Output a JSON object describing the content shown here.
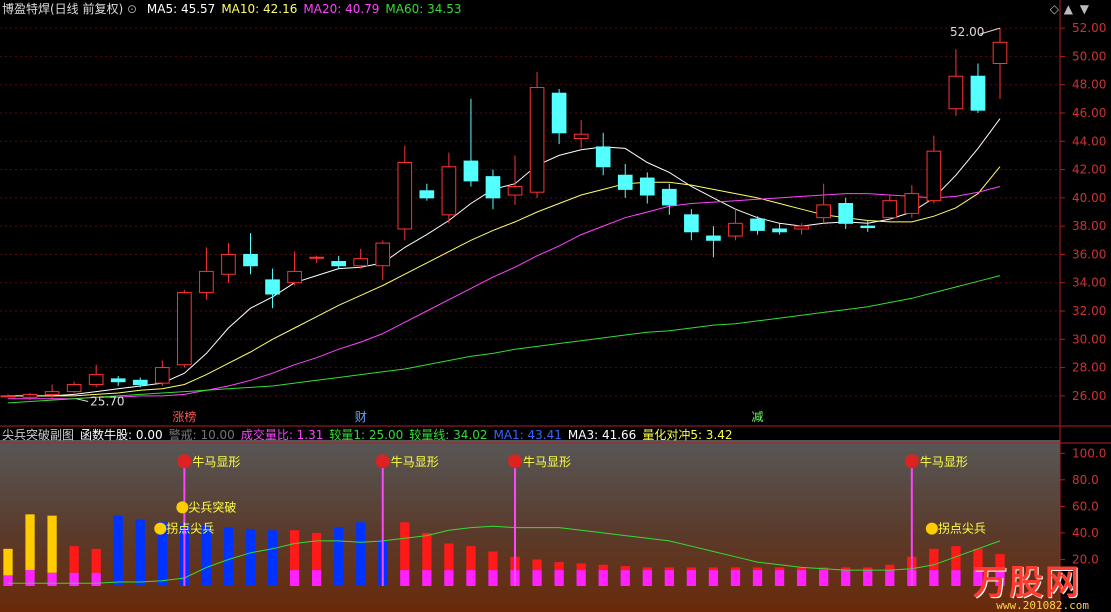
{
  "header": {
    "stock": "博盈特焊(日线 前复权)",
    "ma": [
      {
        "label": "MA5: 45.57",
        "color": "#ffffff"
      },
      {
        "label": "MA10: 42.16",
        "color": "#ffff66"
      },
      {
        "label": "MA20: 40.79",
        "color": "#ff44ff"
      },
      {
        "label": "MA60: 34.53",
        "color": "#33dd33"
      }
    ]
  },
  "sub_header": [
    {
      "text": "尖兵突破副图",
      "color": "#cfcfcf"
    },
    {
      "text": "函数牛股: 0.00",
      "color": "#ffffff"
    },
    {
      "text": "警戒: 10.00",
      "color": "#777777"
    },
    {
      "text": "成交量比: 1.31",
      "color": "#ff44ff"
    },
    {
      "text": "较量1: 25.00",
      "color": "#33dd33"
    },
    {
      "text": "较量线: 34.02",
      "color": "#33dd33"
    },
    {
      "text": "MA1: 43.41",
      "color": "#3366ff"
    },
    {
      "text": "MA3: 41.66",
      "color": "#ffffff"
    },
    {
      "text": "量化对冲5: 3.42",
      "color": "#ffff44"
    }
  ],
  "markers": [
    {
      "text": "涨榜",
      "color": "#ff5555",
      "idx": 8
    },
    {
      "text": "财",
      "color": "#66aaff",
      "idx": 16
    },
    {
      "text": "减",
      "color": "#66ff66",
      "idx": 34
    }
  ],
  "annotations": {
    "high_label": "52.00",
    "low_label": "25.70"
  },
  "watermark": {
    "brand": "万股网",
    "url": "www.201082.com"
  },
  "chart_data": [
    {
      "type": "candlestick",
      "name": "main",
      "ylim": [
        25.0,
        53.0
      ],
      "yticks": [
        26.0,
        28.0,
        30.0,
        32.0,
        34.0,
        36.0,
        38.0,
        40.0,
        42.0,
        44.0,
        46.0,
        48.0,
        50.0,
        52.0
      ],
      "candles": [
        {
          "o": 26.0,
          "c": 26.0,
          "h": 26.1,
          "l": 25.9
        },
        {
          "o": 25.9,
          "c": 26.1,
          "h": 26.2,
          "l": 25.7
        },
        {
          "o": 26.1,
          "c": 26.3,
          "h": 26.8,
          "l": 25.8
        },
        {
          "o": 26.3,
          "c": 26.8,
          "h": 27.0,
          "l": 26.2
        },
        {
          "o": 26.8,
          "c": 27.5,
          "h": 28.2,
          "l": 26.6
        },
        {
          "o": 27.2,
          "c": 27.0,
          "h": 27.4,
          "l": 26.7
        },
        {
          "o": 27.1,
          "c": 26.8,
          "h": 27.3,
          "l": 26.6
        },
        {
          "o": 26.9,
          "c": 28.0,
          "h": 28.5,
          "l": 26.7
        },
        {
          "o": 28.2,
          "c": 33.3,
          "h": 33.5,
          "l": 28.0
        },
        {
          "o": 33.3,
          "c": 34.8,
          "h": 36.5,
          "l": 32.8
        },
        {
          "o": 34.6,
          "c": 36.0,
          "h": 36.8,
          "l": 34.0
        },
        {
          "o": 36.0,
          "c": 35.2,
          "h": 37.5,
          "l": 34.6
        },
        {
          "o": 34.2,
          "c": 33.2,
          "h": 35.0,
          "l": 32.2
        },
        {
          "o": 34.0,
          "c": 34.8,
          "h": 36.2,
          "l": 33.8
        },
        {
          "o": 35.8,
          "c": 35.8,
          "h": 35.9,
          "l": 35.4
        },
        {
          "o": 35.5,
          "c": 35.2,
          "h": 35.9,
          "l": 35.0
        },
        {
          "o": 35.2,
          "c": 35.7,
          "h": 36.4,
          "l": 35.0
        },
        {
          "o": 35.2,
          "c": 36.8,
          "h": 37.0,
          "l": 34.2
        },
        {
          "o": 37.8,
          "c": 42.5,
          "h": 43.7,
          "l": 37.0
        },
        {
          "o": 40.5,
          "c": 40.0,
          "h": 41.0,
          "l": 39.8
        },
        {
          "o": 38.8,
          "c": 42.2,
          "h": 43.2,
          "l": 38.2
        },
        {
          "o": 42.6,
          "c": 41.2,
          "h": 47.0,
          "l": 40.8
        },
        {
          "o": 41.5,
          "c": 40.0,
          "h": 42.0,
          "l": 39.2
        },
        {
          "o": 40.2,
          "c": 40.8,
          "h": 43.0,
          "l": 39.5
        },
        {
          "o": 40.4,
          "c": 47.8,
          "h": 48.9,
          "l": 40.0
        },
        {
          "o": 47.4,
          "c": 44.6,
          "h": 47.7,
          "l": 43.8
        },
        {
          "o": 44.2,
          "c": 44.5,
          "h": 45.5,
          "l": 43.5
        },
        {
          "o": 43.6,
          "c": 42.2,
          "h": 44.6,
          "l": 41.6
        },
        {
          "o": 41.6,
          "c": 40.6,
          "h": 42.4,
          "l": 40.0
        },
        {
          "o": 41.4,
          "c": 40.2,
          "h": 41.8,
          "l": 39.6
        },
        {
          "o": 40.6,
          "c": 39.5,
          "h": 41.0,
          "l": 38.8
        },
        {
          "o": 38.8,
          "c": 37.6,
          "h": 39.2,
          "l": 37.0
        },
        {
          "o": 37.3,
          "c": 37.0,
          "h": 38.0,
          "l": 35.8
        },
        {
          "o": 37.3,
          "c": 38.2,
          "h": 39.2,
          "l": 37.0
        },
        {
          "o": 38.5,
          "c": 37.7,
          "h": 38.7,
          "l": 37.4
        },
        {
          "o": 37.8,
          "c": 37.6,
          "h": 38.2,
          "l": 37.4
        },
        {
          "o": 37.8,
          "c": 38.0,
          "h": 38.2,
          "l": 37.4
        },
        {
          "o": 38.6,
          "c": 39.5,
          "h": 41.0,
          "l": 38.2
        },
        {
          "o": 39.6,
          "c": 38.2,
          "h": 40.0,
          "l": 37.8
        },
        {
          "o": 38.0,
          "c": 37.9,
          "h": 38.4,
          "l": 37.6
        },
        {
          "o": 38.6,
          "c": 39.8,
          "h": 40.2,
          "l": 38.4
        },
        {
          "o": 38.9,
          "c": 40.3,
          "h": 40.9,
          "l": 38.6
        },
        {
          "o": 39.8,
          "c": 43.3,
          "h": 44.4,
          "l": 39.6
        },
        {
          "o": 46.3,
          "c": 48.6,
          "h": 50.5,
          "l": 45.8
        },
        {
          "o": 48.6,
          "c": 46.2,
          "h": 49.5,
          "l": 46.0
        },
        {
          "o": 49.5,
          "c": 51.0,
          "h": 52.0,
          "l": 47.0
        }
      ],
      "series": [
        {
          "name": "MA5",
          "color": "#ffffff",
          "values": [
            26.0,
            26.0,
            26.0,
            26.1,
            26.3,
            26.5,
            26.7,
            26.9,
            27.6,
            29.0,
            30.8,
            32.2,
            33.0,
            34.0,
            34.5,
            35.0,
            35.1,
            35.4,
            36.5,
            37.4,
            38.4,
            39.6,
            40.6,
            41.0,
            42.3,
            43.0,
            43.4,
            43.6,
            43.5,
            42.5,
            41.8,
            40.8,
            40.0,
            39.2,
            38.6,
            38.2,
            38.0,
            38.2,
            38.3,
            38.2,
            38.5,
            39.0,
            40.0,
            41.6,
            43.5,
            45.6
          ]
        },
        {
          "name": "MA10",
          "color": "#ffff66",
          "values": [
            26.0,
            26.0,
            26.0,
            26.0,
            26.1,
            26.2,
            26.4,
            26.5,
            26.8,
            27.5,
            28.3,
            29.1,
            30.0,
            30.8,
            31.6,
            32.4,
            33.1,
            33.8,
            34.6,
            35.4,
            36.2,
            37.0,
            37.7,
            38.3,
            39.0,
            39.6,
            40.2,
            40.6,
            41.0,
            41.1,
            41.1,
            40.9,
            40.6,
            40.3,
            40.0,
            39.6,
            39.2,
            38.8,
            38.6,
            38.4,
            38.3,
            38.3,
            38.7,
            39.3,
            40.3,
            42.2
          ]
        },
        {
          "name": "MA20",
          "color": "#ff44ff",
          "values": [
            25.8,
            25.8,
            25.8,
            25.8,
            25.9,
            25.9,
            26.0,
            26.0,
            26.1,
            26.4,
            26.7,
            27.1,
            27.6,
            28.2,
            28.7,
            29.3,
            29.8,
            30.4,
            31.2,
            32.0,
            32.8,
            33.6,
            34.4,
            35.1,
            35.9,
            36.6,
            37.4,
            38.0,
            38.6,
            39.0,
            39.4,
            39.6,
            39.7,
            39.8,
            39.9,
            40.0,
            40.1,
            40.2,
            40.3,
            40.3,
            40.2,
            40.1,
            40.0,
            40.1,
            40.4,
            40.8
          ]
        },
        {
          "name": "MA60",
          "color": "#33dd33",
          "values": [
            25.5,
            25.6,
            25.7,
            25.8,
            25.9,
            26.0,
            26.1,
            26.2,
            26.3,
            26.4,
            26.5,
            26.6,
            26.7,
            26.9,
            27.1,
            27.3,
            27.5,
            27.7,
            27.9,
            28.2,
            28.5,
            28.8,
            29.0,
            29.3,
            29.5,
            29.7,
            29.9,
            30.1,
            30.3,
            30.5,
            30.6,
            30.8,
            31.0,
            31.1,
            31.3,
            31.5,
            31.7,
            31.9,
            32.1,
            32.3,
            32.6,
            32.9,
            33.3,
            33.7,
            34.1,
            34.5
          ]
        }
      ]
    },
    {
      "type": "bar",
      "name": "sub",
      "ylim": [
        0,
        110
      ],
      "yticks": [
        20.0,
        40.0,
        60.0,
        80.0,
        100.0
      ],
      "line": {
        "color": "#33dd33",
        "values": [
          2,
          2,
          2,
          2,
          2,
          3,
          3,
          4,
          6,
          14,
          20,
          25,
          28,
          32,
          34,
          34,
          33,
          34,
          36,
          38,
          42,
          44,
          45,
          44,
          44,
          44,
          42,
          40,
          38,
          36,
          34,
          30,
          26,
          22,
          18,
          16,
          14,
          13,
          12,
          12,
          12,
          13,
          16,
          22,
          28,
          34
        ]
      },
      "bars": [
        {
          "color": "#ffcc00",
          "value": 28,
          "base": 8
        },
        {
          "color": "#ffcc00",
          "value": 54,
          "base": 12
        },
        {
          "color": "#ffcc00",
          "value": 53,
          "base": 10
        },
        {
          "color": "#ff1a1a",
          "value": 30,
          "base": 10
        },
        {
          "color": "#ff1a1a",
          "value": 28,
          "base": 10
        },
        {
          "color": "#0033ff",
          "value": 53
        },
        {
          "color": "#0033ff",
          "value": 50
        },
        {
          "color": "#0033ff",
          "value": 48
        },
        {
          "color": "#0033ff",
          "value": 47
        },
        {
          "color": "#0033ff",
          "value": 46
        },
        {
          "color": "#0033ff",
          "value": 44
        },
        {
          "color": "#0033ff",
          "value": 43
        },
        {
          "color": "#0033ff",
          "value": 42
        },
        {
          "color": "#ff1a1a",
          "value": 42,
          "base": 12
        },
        {
          "color": "#ff1a1a",
          "value": 40,
          "base": 12
        },
        {
          "color": "#0033ff",
          "value": 44
        },
        {
          "color": "#0033ff",
          "value": 48
        },
        {
          "color": "#0033ff",
          "value": 35
        },
        {
          "color": "#ff1a1a",
          "value": 48,
          "base": 12
        },
        {
          "color": "#ff1a1a",
          "value": 40,
          "base": 12
        },
        {
          "color": "#ff1a1a",
          "value": 32,
          "base": 12
        },
        {
          "color": "#ff1a1a",
          "value": 30,
          "base": 12
        },
        {
          "color": "#ff1a1a",
          "value": 26,
          "base": 12
        },
        {
          "color": "#ff1a1a",
          "value": 22,
          "base": 12
        },
        {
          "color": "#ff1a1a",
          "value": 20,
          "base": 12
        },
        {
          "color": "#ff1a1a",
          "value": 18,
          "base": 12
        },
        {
          "color": "#ff1a1a",
          "value": 17,
          "base": 12
        },
        {
          "color": "#ff1a1a",
          "value": 16,
          "base": 12
        },
        {
          "color": "#ff1a1a",
          "value": 15,
          "base": 12
        },
        {
          "color": "#ff1a1a",
          "value": 14,
          "base": 12
        },
        {
          "color": "#ff1a1a",
          "value": 14,
          "base": 12
        },
        {
          "color": "#ff1a1a",
          "value": 14,
          "base": 12
        },
        {
          "color": "#ff1a1a",
          "value": 14,
          "base": 12
        },
        {
          "color": "#ff1a1a",
          "value": 14,
          "base": 12
        },
        {
          "color": "#ff1a1a",
          "value": 14,
          "base": 12
        },
        {
          "color": "#ff1a1a",
          "value": 14,
          "base": 12
        },
        {
          "color": "#ff1a1a",
          "value": 14,
          "base": 12
        },
        {
          "color": "#ff1a1a",
          "value": 14,
          "base": 12
        },
        {
          "color": "#ff1a1a",
          "value": 14,
          "base": 12
        },
        {
          "color": "#ff1a1a",
          "value": 14,
          "base": 12
        },
        {
          "color": "#ff1a1a",
          "value": 16,
          "base": 12
        },
        {
          "color": "#ff1a1a",
          "value": 22,
          "base": 12
        },
        {
          "color": "#ff1a1a",
          "value": 28,
          "base": 12
        },
        {
          "color": "#ff1a1a",
          "value": 30,
          "base": 12
        },
        {
          "color": "#ff1a1a",
          "value": 28,
          "base": 12
        },
        {
          "color": "#ff1a1a",
          "value": 24,
          "base": 12
        }
      ],
      "signals": [
        {
          "idx": 8,
          "text": "牛马显形",
          "value": 94,
          "color": "#ff44ff"
        },
        {
          "idx": 17,
          "text": "牛马显形",
          "value": 94,
          "color": "#ff44ff"
        },
        {
          "idx": 23,
          "text": "牛马显形",
          "value": 94,
          "color": "#ff44ff"
        },
        {
          "idx": 41,
          "text": "牛马显形",
          "value": 94,
          "color": "#ff44ff"
        }
      ],
      "tags": [
        {
          "idx": 7,
          "text": "拐点尖兵",
          "value": 44
        },
        {
          "idx": 8,
          "text": "尖兵突破",
          "value": 60
        },
        {
          "idx": 42,
          "text": "拐点尖兵",
          "value": 44
        }
      ]
    }
  ]
}
